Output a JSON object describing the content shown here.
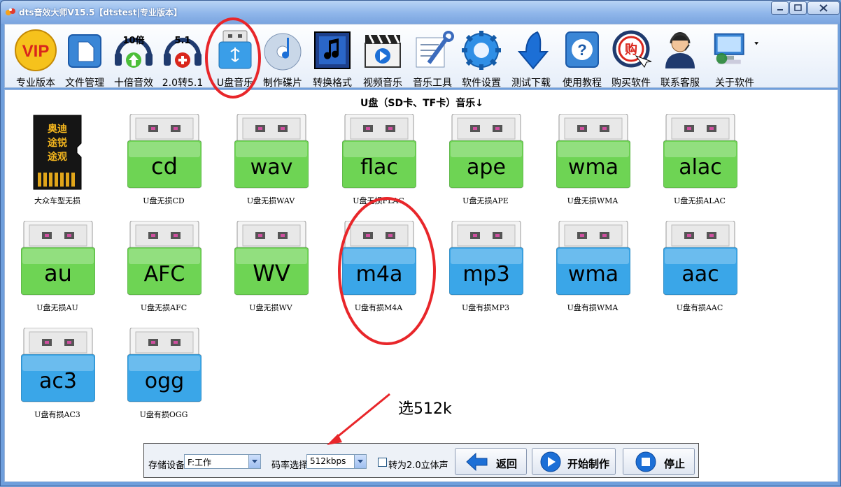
{
  "window": {
    "title": "dts音效大师V15.5【dtstest|专业版本】",
    "accent": "#7aa4df"
  },
  "toolbar": {
    "items": [
      {
        "label": "专业版本",
        "icon": "vip-badge-icon"
      },
      {
        "label": "文件管理",
        "icon": "file-manager-icon"
      },
      {
        "label": "十倍音效",
        "icon": "tenfold-sound-icon",
        "badge": "10倍"
      },
      {
        "label": "2.0转5.1",
        "icon": "surround-convert-icon",
        "badge": "5.1"
      },
      {
        "label": "U盘音乐",
        "icon": "usb-drive-icon"
      },
      {
        "label": "制作碟片",
        "icon": "cd-disc-icon"
      },
      {
        "label": "转换格式",
        "icon": "music-note-icon"
      },
      {
        "label": "视频音乐",
        "icon": "clapperboard-icon"
      },
      {
        "label": "音乐工具",
        "icon": "tools-icon"
      },
      {
        "label": "软件设置",
        "icon": "gear-icon"
      },
      {
        "label": "测试下载",
        "icon": "download-arrow-icon"
      },
      {
        "label": "使用教程",
        "icon": "help-question-icon"
      },
      {
        "label": "购买软件",
        "icon": "buy-icon",
        "badge": "购"
      },
      {
        "label": "联系客服",
        "icon": "support-agent-icon"
      },
      {
        "label": "关于软件",
        "icon": "about-computer-icon"
      }
    ]
  },
  "content": {
    "heading": "U盘（SD卡、TF卡）音乐↓",
    "sd_card_text": [
      "奥迪",
      "途锐",
      "途观"
    ],
    "items": [
      {
        "format": "",
        "caption": "大众车型无损",
        "kind": "sdcard"
      },
      {
        "format": "cd",
        "caption": "U盘无损CD",
        "kind": "lossless"
      },
      {
        "format": "wav",
        "caption": "U盘无损WAV",
        "kind": "lossless"
      },
      {
        "format": "flac",
        "caption": "U盘无损FLAC",
        "kind": "lossless"
      },
      {
        "format": "ape",
        "caption": "U盘无损APE",
        "kind": "lossless"
      },
      {
        "format": "wma",
        "caption": "U盘无损WMA",
        "kind": "lossless"
      },
      {
        "format": "alac",
        "caption": "U盘无损ALAC",
        "kind": "lossless"
      },
      {
        "format": "au",
        "caption": "U盘无损AU",
        "kind": "lossless"
      },
      {
        "format": "AFC",
        "caption": "U盘无损AFC",
        "kind": "lossless"
      },
      {
        "format": "WV",
        "caption": "U盘无损WV",
        "kind": "lossless"
      },
      {
        "format": "m4a",
        "caption": "U盘有损M4A",
        "kind": "lossy"
      },
      {
        "format": "mp3",
        "caption": "U盘有损MP3",
        "kind": "lossy"
      },
      {
        "format": "wma",
        "caption": "U盘有损WMA",
        "kind": "lossy"
      },
      {
        "format": "aac",
        "caption": "U盘有损AAC",
        "kind": "lossy"
      },
      {
        "format": "ac3",
        "caption": "U盘有损AC3",
        "kind": "lossy"
      },
      {
        "format": "ogg",
        "caption": "U盘有损OGG",
        "kind": "lossy"
      }
    ],
    "colors": {
      "lossless": "#6ed454",
      "lossy": "#3aa6e8",
      "annotation": "#e8262a"
    }
  },
  "annotation": {
    "text": "选512k"
  },
  "bottom": {
    "device_label": "存储设备",
    "device_value": "F:工作",
    "bitrate_label": "码率选择",
    "bitrate_value": "512kbps",
    "stereo_label": "转为2.0立体声",
    "back_label": "返回",
    "start_label": "开始制作",
    "stop_label": "停止"
  }
}
